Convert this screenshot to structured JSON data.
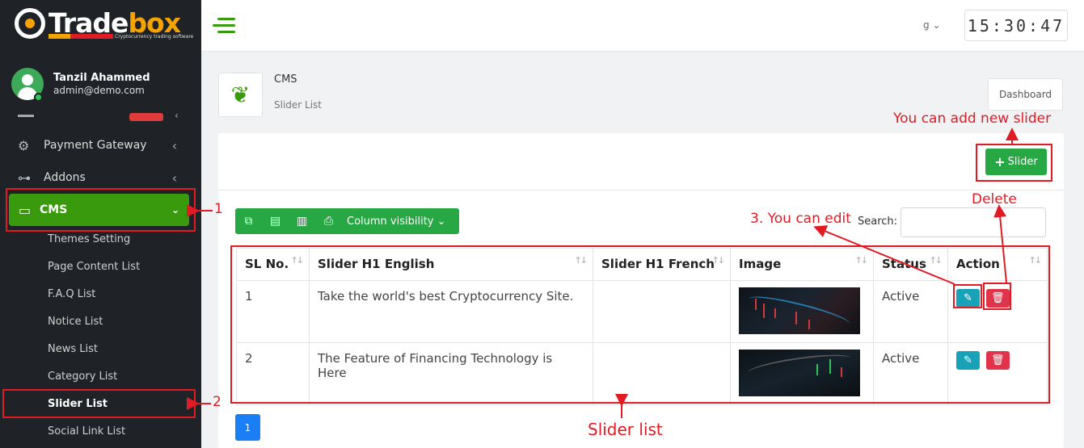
{
  "brand": {
    "name_main": "Trade",
    "name_accent": "box",
    "tagline": "Cryptocurrency trading software"
  },
  "user": {
    "name": "Tanzil Ahammed",
    "email": "admin@demo.com"
  },
  "sidebar": {
    "items": [
      {
        "label": "Payment Gateway",
        "icon": "gears-icon"
      },
      {
        "label": "Addons",
        "icon": "sitemap-icon"
      }
    ],
    "cms": {
      "label": "CMS",
      "icon": "comment-icon"
    },
    "sub_items": [
      "Themes Setting",
      "Page Content List",
      "F.A.Q List",
      "Notice List",
      "News List",
      "Category List",
      "Slider List",
      "Social Link List"
    ],
    "active_sub": "Slider List"
  },
  "topbar": {
    "lang": "g",
    "clock": "15:30:47"
  },
  "breadcrumb": {
    "title": "CMS",
    "subtitle": "Slider List",
    "dashboard_label": "Dashboard"
  },
  "actions": {
    "add_slider_label": "Slider"
  },
  "toolbar": {
    "column_visibility": "Column visibility",
    "search_label": "Search:"
  },
  "table": {
    "headers": [
      "SL No.",
      "Slider H1 English",
      "Slider H1 French",
      "Image",
      "Status",
      "Action"
    ],
    "rows": [
      {
        "sl": "1",
        "english": "Take the world's best Cryptocurrency Site.",
        "french": "",
        "status": "Active"
      },
      {
        "sl": "2",
        "english": "The Feature of Financing Technology is Here",
        "french": "",
        "status": "Active"
      }
    ]
  },
  "pagination": {
    "current": "1"
  },
  "annotations": {
    "one": "1",
    "two": "2",
    "add_new": "You can add new slider",
    "delete": "Delete",
    "edit": "3. You can edit",
    "slider_list": "Slider list"
  },
  "colors": {
    "accent_green": "#3a9a0d",
    "button_green": "#28a745",
    "annotation_red": "#e01b24",
    "sidebar_bg": "#1f2327"
  }
}
